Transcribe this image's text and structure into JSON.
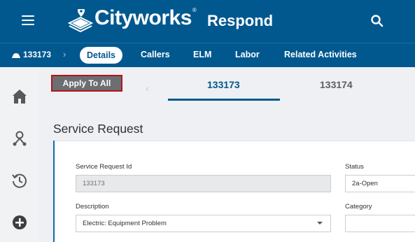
{
  "header": {
    "brand": "Cityworks",
    "brand_mark": "®",
    "product": "Respond",
    "icons": [
      "hamburger-menu-icon",
      "cityworks-logo",
      "search-icon"
    ]
  },
  "tabbar": {
    "record_id": "133173",
    "tabs": [
      {
        "label": "Details",
        "active": true
      },
      {
        "label": "Callers",
        "active": false
      },
      {
        "label": "ELM",
        "active": false
      },
      {
        "label": "Labor",
        "active": false
      },
      {
        "label": "Related Activities",
        "active": false
      }
    ]
  },
  "leftnav": {
    "items": [
      "home-icon",
      "people-icon",
      "history-icon",
      "add-circle-icon"
    ]
  },
  "toolbar": {
    "apply_all_label": "Apply To All"
  },
  "records": [
    {
      "id": "133173",
      "active": true
    },
    {
      "id": "133174",
      "active": false
    }
  ],
  "section": {
    "title": "Service Request"
  },
  "form": {
    "service_request_id": {
      "label": "Service Request Id",
      "value": "133173"
    },
    "status": {
      "label": "Status",
      "value": "2a-Open"
    },
    "description": {
      "label": "Description",
      "value": "Electric: Equipment Problem"
    },
    "category": {
      "label": "Category",
      "value": ""
    }
  },
  "colors": {
    "primary": "#00588f",
    "button_bg": "#6d6e72",
    "button_border": "#b5131a"
  }
}
